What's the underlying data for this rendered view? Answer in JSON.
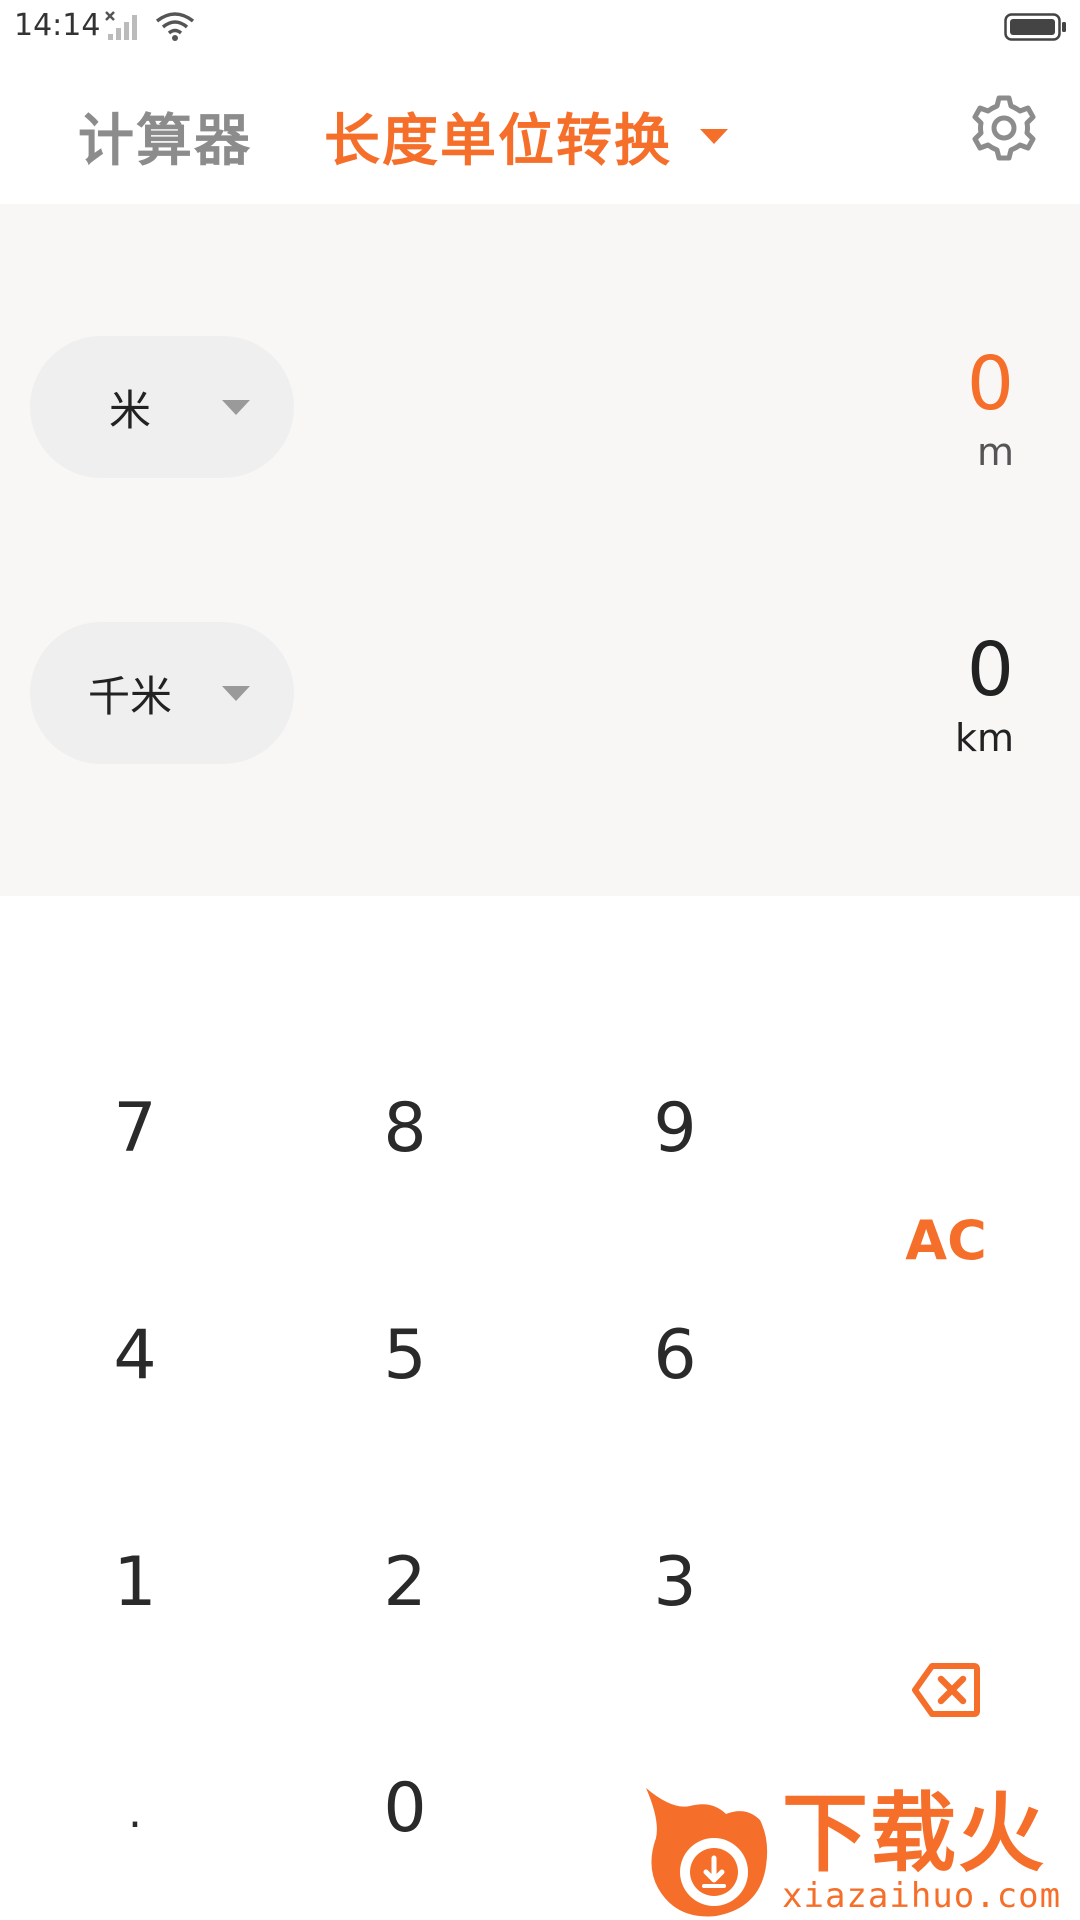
{
  "status_bar": {
    "time": "14:14",
    "icons": [
      "signal-icon",
      "wifi-icon",
      "battery-icon"
    ]
  },
  "header": {
    "tab_calculator": "计算器",
    "tab_converter": "长度单位转换",
    "icons": [
      "chevron-down-icon",
      "gear-icon"
    ]
  },
  "converter": {
    "from_unit": "米",
    "from_value": "0",
    "from_symbol": "m",
    "to_unit": "千米",
    "to_value": "0",
    "to_symbol": "km"
  },
  "keypad": {
    "keys": [
      "7",
      "8",
      "9",
      "4",
      "5",
      "6",
      "1",
      "2",
      "3",
      ".",
      "0"
    ],
    "clear_label": "AC",
    "backspace_icon": "backspace-icon"
  },
  "watermark": {
    "title": "下载火",
    "url": "xiazaihuo.com"
  },
  "colors": {
    "accent": "#f56f2a",
    "panel_background": "#f8f7f6",
    "pill_background": "#efefef",
    "inactive_tab": "#8c8c8c"
  }
}
